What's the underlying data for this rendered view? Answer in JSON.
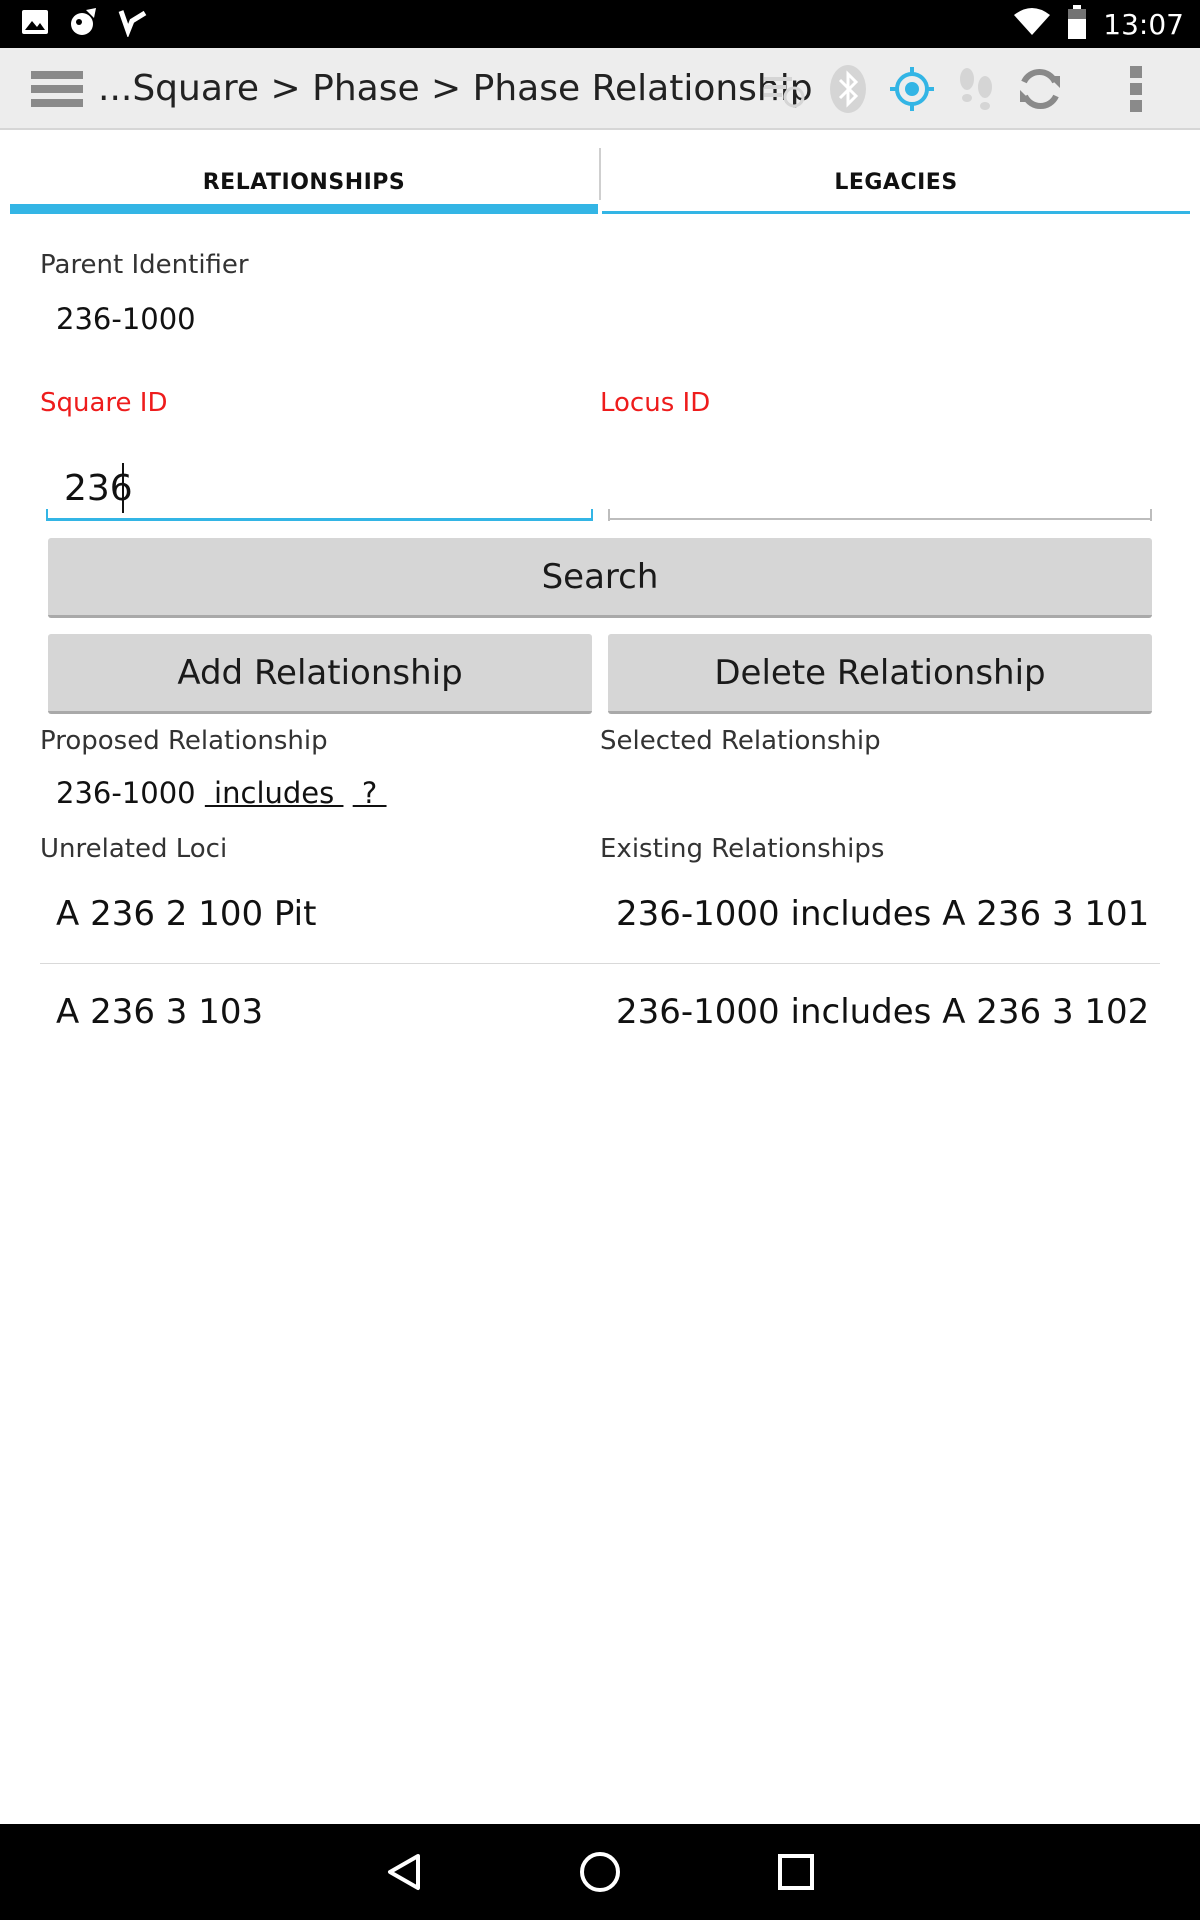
{
  "status_bar": {
    "time": "13:07",
    "left_icons": [
      "image-icon",
      "app-icon",
      "check-icon"
    ],
    "right_icons": [
      "wifi-icon",
      "battery-icon"
    ]
  },
  "action_bar": {
    "title": "...Square > Phase > Phase Relationship",
    "icons": [
      "sync-off-icon",
      "bluetooth-icon",
      "gps-target-icon",
      "footsteps-icon",
      "refresh-icon",
      "overflow-menu-icon"
    ]
  },
  "tabs": [
    {
      "label": "RELATIONSHIPS",
      "selected": true
    },
    {
      "label": "LEGACIES",
      "selected": false
    }
  ],
  "form": {
    "parent_identifier_label": "Parent Identifier",
    "parent_identifier_value": "236-1000",
    "square_id_label": "Square ID",
    "square_id_value": "236",
    "locus_id_label": "Locus ID",
    "locus_id_value": ""
  },
  "buttons": {
    "search": "Search",
    "add_relationship": "Add Relationship",
    "delete_relationship": "Delete Relationship"
  },
  "proposed": {
    "label": "Proposed Relationship",
    "parent": "236-1000",
    "relation": " includes ",
    "target": " ? "
  },
  "selected": {
    "label": "Selected Relationship",
    "value": ""
  },
  "unrelated_loci": {
    "label": "Unrelated Loci",
    "items": [
      "A 236 2 100 Pit",
      "A 236 3 103"
    ]
  },
  "existing_relationships": {
    "label": "Existing Relationships",
    "items": [
      "236-1000 includes A 236 3 101",
      "236-1000 includes A 236 3 102"
    ]
  },
  "colors": {
    "accent": "#33b5e5",
    "required_label": "#ee1c1c",
    "button": "#d6d6d6",
    "action_bar": "#ededed"
  },
  "nav_bar": {
    "icons": [
      "back-icon",
      "home-icon",
      "recents-icon"
    ]
  }
}
